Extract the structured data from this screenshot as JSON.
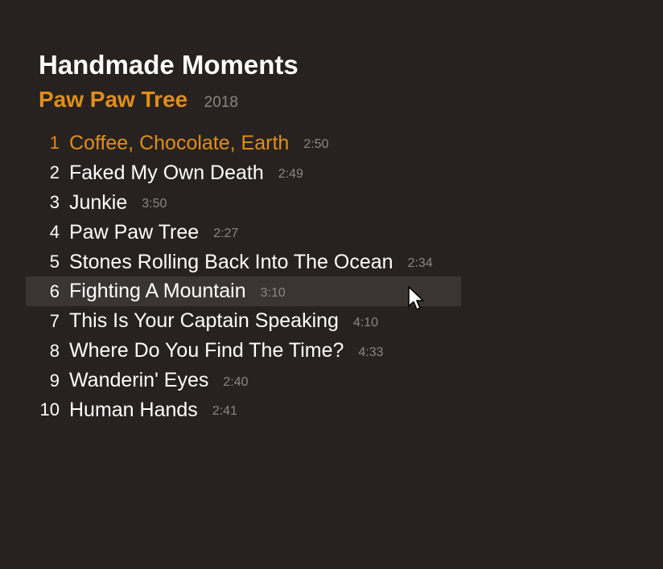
{
  "album": {
    "title": "Handmade Moments",
    "artist": "Paw Paw Tree",
    "year": "2018"
  },
  "tracks": [
    {
      "number": "1",
      "name": "Coffee, Chocolate, Earth",
      "duration": "2:50"
    },
    {
      "number": "2",
      "name": "Faked My Own Death",
      "duration": "2:49"
    },
    {
      "number": "3",
      "name": "Junkie",
      "duration": "3:50"
    },
    {
      "number": "4",
      "name": "Paw Paw Tree",
      "duration": "2:27"
    },
    {
      "number": "5",
      "name": "Stones Rolling Back Into The Ocean",
      "duration": "2:34"
    },
    {
      "number": "6",
      "name": "Fighting A Mountain",
      "duration": "3:10"
    },
    {
      "number": "7",
      "name": "This Is Your Captain Speaking",
      "duration": "4:10"
    },
    {
      "number": "8",
      "name": "Where Do You Find The Time?",
      "duration": "4:33"
    },
    {
      "number": "9",
      "name": "Wanderin' Eyes",
      "duration": "2:40"
    },
    {
      "number": "10",
      "name": "Human Hands",
      "duration": "2:41"
    }
  ],
  "state": {
    "active_track": "1",
    "hovered_track": "6"
  },
  "colors": {
    "background": "#272220",
    "accent": "#e08e1b",
    "text": "#ffffff",
    "muted": "#8d8580",
    "hover": "#3a3533"
  },
  "icons": {
    "cursor": "pointer-cursor-icon"
  }
}
